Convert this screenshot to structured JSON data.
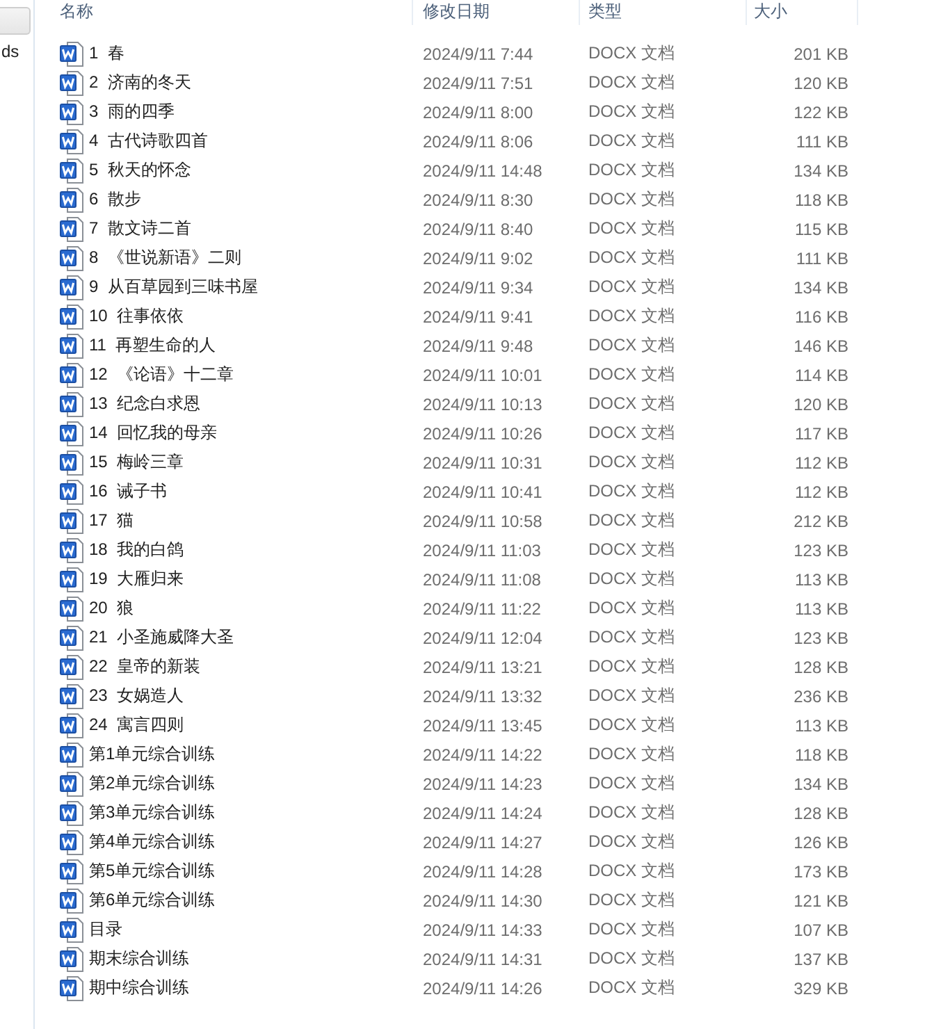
{
  "sidebar": {
    "text": "ds"
  },
  "columns": [
    "名称",
    "修改日期",
    "类型",
    "大小"
  ],
  "rows": [
    {
      "name": "1  春",
      "date": "2024/9/11 7:44",
      "type": "DOCX 文档",
      "size": "201 KB"
    },
    {
      "name": "2  济南的冬天",
      "date": "2024/9/11 7:51",
      "type": "DOCX 文档",
      "size": "120 KB"
    },
    {
      "name": "3  雨的四季",
      "date": "2024/9/11 8:00",
      "type": "DOCX 文档",
      "size": "122 KB"
    },
    {
      "name": "4  古代诗歌四首",
      "date": "2024/9/11 8:06",
      "type": "DOCX 文档",
      "size": "111 KB"
    },
    {
      "name": "5  秋天的怀念",
      "date": "2024/9/11 14:48",
      "type": "DOCX 文档",
      "size": "134 KB"
    },
    {
      "name": "6  散步",
      "date": "2024/9/11 8:30",
      "type": "DOCX 文档",
      "size": "118 KB"
    },
    {
      "name": "7  散文诗二首",
      "date": "2024/9/11 8:40",
      "type": "DOCX 文档",
      "size": "115 KB"
    },
    {
      "name": "8  《世说新语》二则",
      "date": "2024/9/11 9:02",
      "type": "DOCX 文档",
      "size": "111 KB"
    },
    {
      "name": "9  从百草园到三味书屋",
      "date": "2024/9/11 9:34",
      "type": "DOCX 文档",
      "size": "134 KB"
    },
    {
      "name": "10  往事依依",
      "date": "2024/9/11 9:41",
      "type": "DOCX 文档",
      "size": "116 KB"
    },
    {
      "name": "11  再塑生命的人",
      "date": "2024/9/11 9:48",
      "type": "DOCX 文档",
      "size": "146 KB"
    },
    {
      "name": "12  《论语》十二章",
      "date": "2024/9/11 10:01",
      "type": "DOCX 文档",
      "size": "114 KB"
    },
    {
      "name": "13  纪念白求恩",
      "date": "2024/9/11 10:13",
      "type": "DOCX 文档",
      "size": "120 KB"
    },
    {
      "name": "14  回忆我的母亲",
      "date": "2024/9/11 10:26",
      "type": "DOCX 文档",
      "size": "117 KB"
    },
    {
      "name": "15  梅岭三章",
      "date": "2024/9/11 10:31",
      "type": "DOCX 文档",
      "size": "112 KB"
    },
    {
      "name": "16  诫子书",
      "date": "2024/9/11 10:41",
      "type": "DOCX 文档",
      "size": "112 KB"
    },
    {
      "name": "17  猫",
      "date": "2024/9/11 10:58",
      "type": "DOCX 文档",
      "size": "212 KB"
    },
    {
      "name": "18  我的白鸽",
      "date": "2024/9/11 11:03",
      "type": "DOCX 文档",
      "size": "123 KB"
    },
    {
      "name": "19  大雁归来",
      "date": "2024/9/11 11:08",
      "type": "DOCX 文档",
      "size": "113 KB"
    },
    {
      "name": "20  狼",
      "date": "2024/9/11 11:22",
      "type": "DOCX 文档",
      "size": "113 KB"
    },
    {
      "name": "21  小圣施威降大圣",
      "date": "2024/9/11 12:04",
      "type": "DOCX 文档",
      "size": "123 KB"
    },
    {
      "name": "22  皇帝的新装",
      "date": "2024/9/11 13:21",
      "type": "DOCX 文档",
      "size": "128 KB"
    },
    {
      "name": "23  女娲造人",
      "date": "2024/9/11 13:32",
      "type": "DOCX 文档",
      "size": "236 KB"
    },
    {
      "name": "24  寓言四则",
      "date": "2024/9/11 13:45",
      "type": "DOCX 文档",
      "size": "113 KB"
    },
    {
      "name": "第1单元综合训练",
      "date": "2024/9/11 14:22",
      "type": "DOCX 文档",
      "size": "118 KB"
    },
    {
      "name": "第2单元综合训练",
      "date": "2024/9/11 14:23",
      "type": "DOCX 文档",
      "size": "134 KB"
    },
    {
      "name": "第3单元综合训练",
      "date": "2024/9/11 14:24",
      "type": "DOCX 文档",
      "size": "128 KB"
    },
    {
      "name": "第4单元综合训练",
      "date": "2024/9/11 14:27",
      "type": "DOCX 文档",
      "size": "126 KB"
    },
    {
      "name": "第5单元综合训练",
      "date": "2024/9/11 14:28",
      "type": "DOCX 文档",
      "size": "173 KB"
    },
    {
      "name": "第6单元综合训练",
      "date": "2024/9/11 14:30",
      "type": "DOCX 文档",
      "size": "121 KB"
    },
    {
      "name": "目录",
      "date": "2024/9/11 14:33",
      "type": "DOCX 文档",
      "size": "107 KB"
    },
    {
      "name": "期末综合训练",
      "date": "2024/9/11 14:31",
      "type": "DOCX 文档",
      "size": "137 KB"
    },
    {
      "name": "期中综合训练",
      "date": "2024/9/11 14:26",
      "type": "DOCX 文档",
      "size": "329 KB"
    }
  ]
}
